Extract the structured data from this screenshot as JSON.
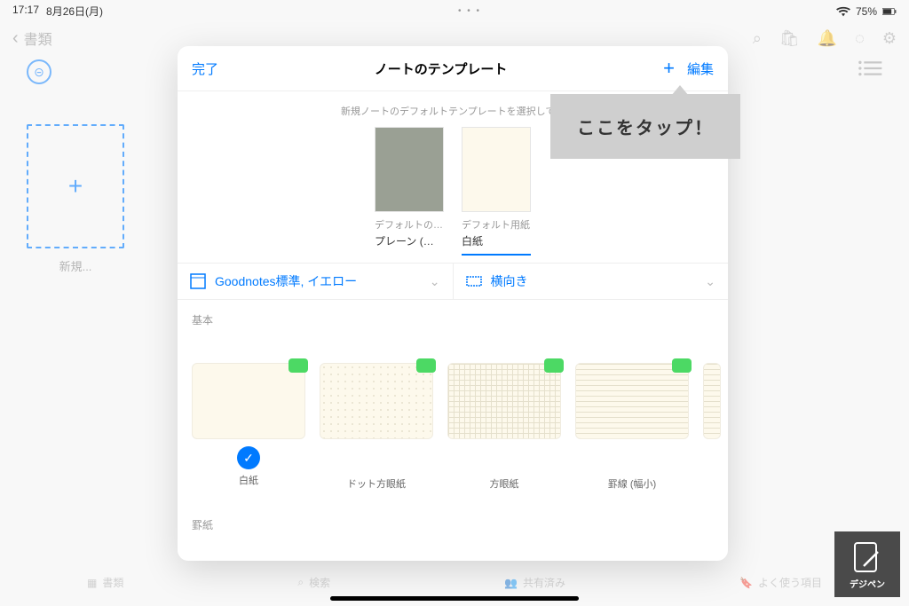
{
  "status": {
    "time": "17:17",
    "date": "8月26日(月)",
    "battery": "75%"
  },
  "header": {
    "back": "書類"
  },
  "new_tile": {
    "label": "新規..."
  },
  "modal": {
    "done": "完了",
    "title": "ノートのテンプレート",
    "edit": "編集",
    "instruction": "新規ノートのデフォルトテンプレートを選択してく",
    "defaults": [
      {
        "caption": "デフォルトの…",
        "sub": "プレーン (…"
      },
      {
        "caption": "デフォルト用紙",
        "sub": "白紙"
      }
    ],
    "paper_option": "Goodnotes標準, イエロー",
    "orientation_option": "横向き",
    "section_basic": "基本",
    "templates": [
      {
        "name": "白紙",
        "selected": true
      },
      {
        "name": "ドット方眼紙",
        "selected": false
      },
      {
        "name": "方眼紙",
        "selected": false
      },
      {
        "name": "罫線 (幅小)",
        "selected": false
      }
    ],
    "section_lined": "罫紙"
  },
  "callout": {
    "text": "ここをタップ！"
  },
  "tabs": {
    "documents": "書類",
    "search": "検索",
    "shared": "共有済み",
    "favorites": "よく使う項目"
  },
  "watermark": {
    "label": "デジペン"
  }
}
